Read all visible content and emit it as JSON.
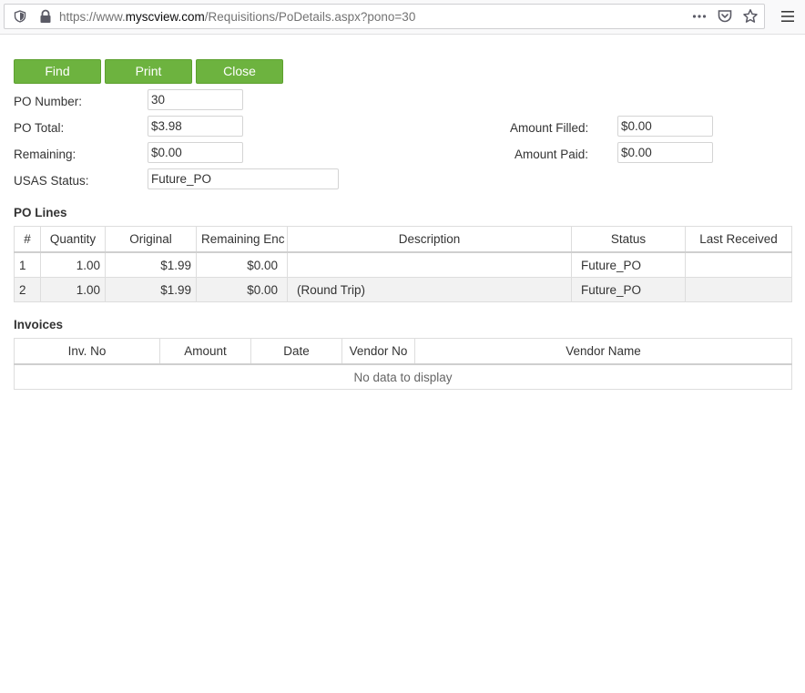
{
  "browser": {
    "url_prefix": "https://www.",
    "url_domain": "myscview.com",
    "url_path": "/Requisitions/PoDetails.aspx?pono=30"
  },
  "buttons": {
    "find": "Find",
    "print": "Print",
    "close": "Close"
  },
  "form": {
    "po_number_label": "PO Number:",
    "po_number": "30",
    "po_total_label": "PO Total:",
    "po_total": "$3.98",
    "remaining_label": "Remaining:",
    "remaining": "$0.00",
    "usas_status_label": "USAS Status:",
    "usas_status": "Future_PO",
    "amount_filled_label": "Amount Filled:",
    "amount_filled": "$0.00",
    "amount_paid_label": "Amount Paid:",
    "amount_paid": "$0.00"
  },
  "po_lines": {
    "title": "PO Lines",
    "columns": [
      "#",
      "Quantity",
      "Original",
      "Remaining Enc",
      "Description",
      "Status",
      "Last Received"
    ],
    "rows": [
      [
        "1",
        "1.00",
        "$1.99",
        "$0.00",
        "",
        "Future_PO",
        ""
      ],
      [
        "2",
        "1.00",
        "$1.99",
        "$0.00",
        "(Round Trip)",
        "Future_PO",
        ""
      ]
    ]
  },
  "invoices": {
    "title": "Invoices",
    "columns": [
      "Inv. No",
      "Amount",
      "Date",
      "Vendor No",
      "Vendor Name"
    ],
    "empty_text": "No data to display"
  }
}
